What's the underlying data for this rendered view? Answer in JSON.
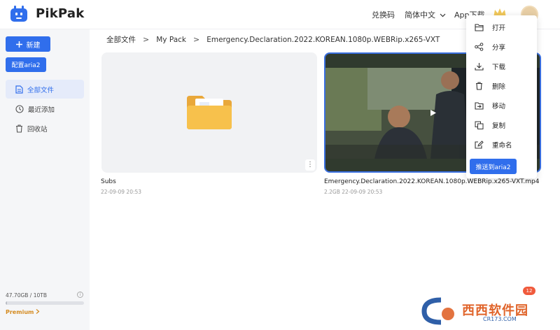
{
  "header": {
    "app_name": "PikPak",
    "redeem": "兑换码",
    "language": "简体中文",
    "app_download": "App下载",
    "icons": [
      "pikpak-logo-icon",
      "chevron-down-icon",
      "crown-icon",
      "avatar"
    ]
  },
  "sidebar": {
    "new_button": "新建",
    "aria_button": "配置aria2",
    "items": [
      {
        "label": "全部文件",
        "icon": "file-icon",
        "active": true
      },
      {
        "label": "最近添加",
        "icon": "clock-icon",
        "active": false
      },
      {
        "label": "回收站",
        "icon": "trash-icon",
        "active": false
      }
    ],
    "storage": "47.70GB / 10TB",
    "storage_used_fraction": 0.005,
    "premium": "Premium"
  },
  "breadcrumb": [
    "全部文件",
    "My Pack",
    "Emergency.Declaration.2022.KOREAN.1080p.WEBRip.x265-VXT"
  ],
  "files": [
    {
      "name": "Subs",
      "meta": "22-09-09 20:53",
      "type": "folder"
    },
    {
      "name": "Emergency.Declaration.2022.KOREAN.1080p.WEBRip.x265-VXT.mp4",
      "meta": "2.2GB    22-09-09 20:53",
      "type": "video"
    }
  ],
  "context_menu": {
    "items": [
      "打开",
      "分享",
      "下载",
      "删除",
      "移动",
      "复制",
      "重命名"
    ],
    "icons": [
      "folder-open-icon",
      "share-icon",
      "download-icon",
      "trash-icon",
      "move-icon",
      "copy-icon",
      "rename-icon"
    ],
    "push_button": "推送到aria2"
  },
  "notification_count": "12",
  "watermark": {
    "text": "西西软件园",
    "sub": "CR173.COM"
  },
  "colors": {
    "accent": "#306eec",
    "folder": "#f7c14c",
    "premium": "#d48a1e",
    "badge": "#f05a3c"
  }
}
